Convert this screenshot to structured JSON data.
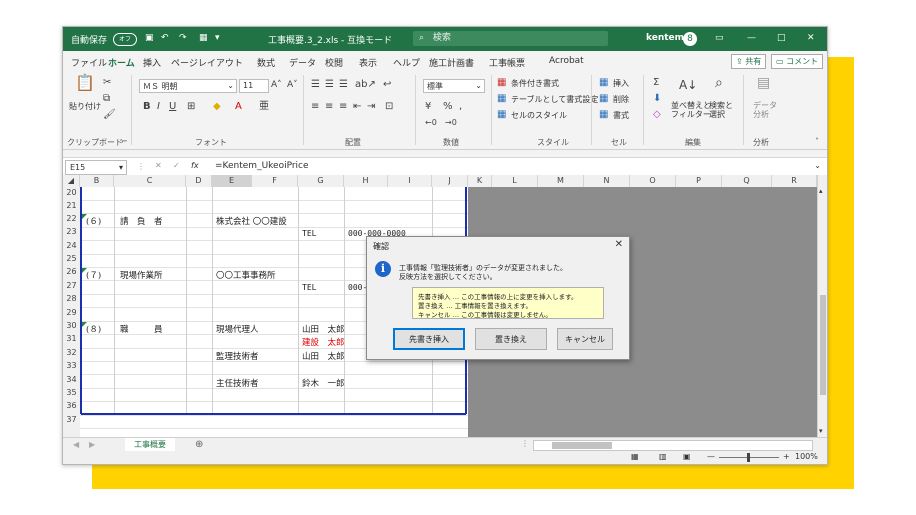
{
  "titlebar": {
    "autosave": "自動保存",
    "toggle": "オフ",
    "filename": "工事概要.3_2.xls - 互換モード",
    "search_placeholder": "検索",
    "user": "kentem",
    "avatar": "8",
    "controls": [
      "—",
      "□",
      "✕"
    ]
  },
  "menu": {
    "items": [
      "ファイル",
      "ホーム",
      "挿入",
      "ページレイアウト",
      "数式",
      "データ",
      "校閲",
      "表示",
      "ヘルプ",
      "施工計画書",
      "工事帳票",
      "Acrobat"
    ],
    "share": "共有",
    "comment": "コメント"
  },
  "ribbon": {
    "paste": "貼り付け",
    "font_name": "ＭＳ 明朝",
    "font_size": "11",
    "number_format": "標準",
    "cond_format": "条件付き書式",
    "table_format": "テーブルとして書式設定",
    "cell_style": "セルのスタイル",
    "insert": "挿入",
    "delete": "削除",
    "format": "書式",
    "sort_filter": "並べ替えと\nフィルター",
    "find_select": "検索と\n選択",
    "data_analysis": "データ\n分析",
    "groups": [
      "クリップボード",
      "フォント",
      "配置",
      "数値",
      "スタイル",
      "セル",
      "編集",
      "分析"
    ]
  },
  "formula": {
    "cell_ref": "E15",
    "fx": "fx",
    "content": "=Kentem_UkeoiPrice"
  },
  "columns": [
    "B",
    "C",
    "D",
    "E",
    "F",
    "G",
    "H",
    "I",
    "J",
    "K",
    "L",
    "M",
    "N",
    "O",
    "P",
    "Q",
    "R"
  ],
  "rows": [
    "20",
    "21",
    "22",
    "23",
    "24",
    "25",
    "26",
    "27",
    "28",
    "29",
    "30",
    "31",
    "32",
    "33",
    "34",
    "35",
    "36",
    "37"
  ],
  "cells": {
    "r22_b": "(６)",
    "r22_c": "請　負　者",
    "r22_e": "株式会社 〇〇建設",
    "r23_g": "TEL",
    "r23_h": "000-000-0000",
    "r26_b": "(７)",
    "r26_c": "現場作業所",
    "r26_e": "〇〇工事事務所",
    "r27_g": "TEL",
    "r27_h": "000-0",
    "r30_b": "(８)",
    "r30_c": "職　　　員",
    "r30_e": "現場代理人",
    "r30_g": "山田　太郎",
    "r31_g": "建設　太郎",
    "r32_e": "監理技術者",
    "r32_g": "山田　太郎",
    "r34_e": "主任技術者",
    "r34_g": "鈴木　一郎"
  },
  "sheet_tab": "工事概要",
  "status": {
    "zoom": "100%"
  },
  "dialog": {
    "title": "確認",
    "line1": "工事情報「監理技術者」のデータが変更されました。",
    "line2": "反映方法を選択してください。",
    "note1": "先書き挿入 … この工事情報の上に変更を挿入します。",
    "note2": "置き換え … 工事情報を置き換えます。",
    "note3": "キャンセル … この工事情報は変更しません。",
    "btn_insert": "先書き挿入",
    "btn_replace": "置き換え",
    "btn_cancel": "キャンセル"
  },
  "colors": {
    "excel_green": "#217346",
    "accent_yellow": "#ffd200",
    "frame_blue": "#1a2fb0",
    "red_text": "#e00000"
  }
}
